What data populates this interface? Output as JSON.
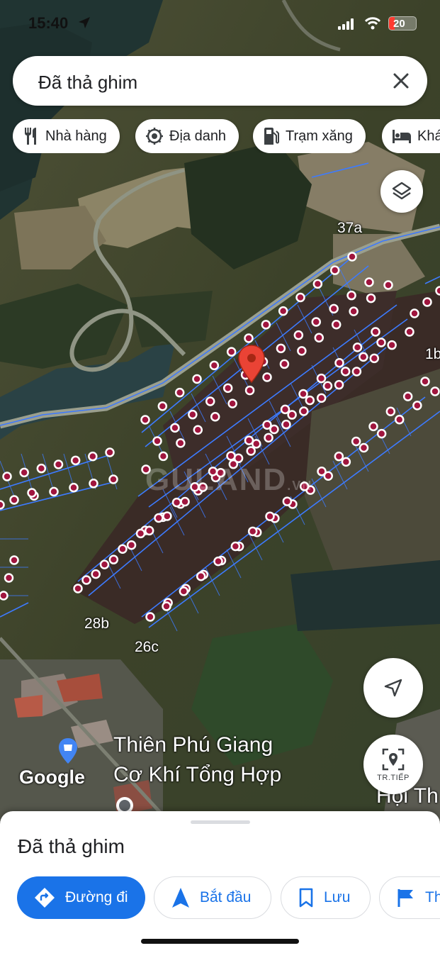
{
  "status_bar": {
    "time": "15:40",
    "battery": "20"
  },
  "search": {
    "query": "Đã thả ghim"
  },
  "chips": [
    {
      "label": "Nhà hàng",
      "icon": "fork-knife-icon"
    },
    {
      "label": "Địa danh",
      "icon": "landmark-icon"
    },
    {
      "label": "Trạm xăng",
      "icon": "gas-station-icon"
    },
    {
      "label": "Khá",
      "icon": "bed-icon"
    }
  ],
  "map": {
    "labels": {
      "a37": "37a",
      "b1": "1b",
      "b28": "28b",
      "c26": "26c",
      "place1": "Thiên Phú Giang",
      "place2": "Cơ Khí Tổng Hợp",
      "place3": "Hội Th"
    },
    "watermark": "GULAND",
    "watermark_suffix": ".VN",
    "attribution": "Google",
    "street_view_label": "TR.TIẾP",
    "accent_color": "#1a73e8",
    "pin_color": "#ea4335",
    "parcel_line_color": "#3d7bff"
  },
  "sheet": {
    "title": "Đã thả ghim",
    "actions": [
      {
        "label": "Đường đi",
        "icon": "directions-icon"
      },
      {
        "label": "Bắt đầu",
        "icon": "navigation-arrow-icon"
      },
      {
        "label": "Lưu",
        "icon": "bookmark-icon"
      },
      {
        "label": "Th",
        "icon": "flag-icon"
      }
    ]
  }
}
